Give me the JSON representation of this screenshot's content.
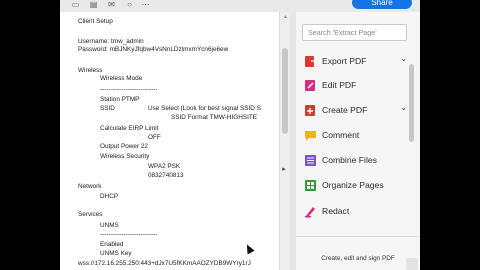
{
  "toolbar": {
    "share_label": "Share",
    "icons": [
      "save-icon",
      "print-icon",
      "mail-icon",
      "search-icon",
      "more-icon"
    ]
  },
  "document": {
    "lines": [
      "Client Setup",
      "Username: tmw_admin",
      "Password: mBJNKyJfqbw4VsNnLDzlmxmYcn6je6ew",
      "Wireless",
      "Wireless Mode",
      "---------------------------",
      "Station PTMP",
      "SSID",
      "Use Select (Look for best signal SSID S",
      "SSID Format   TMW-HIGHSITE",
      "Calculate EIRP Limit",
      "OFF",
      "Output Power 22",
      "Wireless Security",
      "WPA2 PSK",
      "0832740813",
      "Network",
      "DHCP",
      "Services",
      "UNMS",
      "---------------------------",
      "Enabled",
      "UNMS Key",
      "wss://172.16.255.250:443+dJx7U5fKKmAAOZYDB9WYry1rJ"
    ]
  },
  "tools": {
    "search_placeholder": "Search 'Extract Page'",
    "items": [
      {
        "label": "Export PDF",
        "icon": "export-pdf-icon",
        "color": "#d53b2f",
        "has_chevron": true
      },
      {
        "label": "Edit PDF",
        "icon": "edit-pdf-icon",
        "color": "#d0317f",
        "has_chevron": false
      },
      {
        "label": "Create PDF",
        "icon": "create-pdf-icon",
        "color": "#d53b2f",
        "has_chevron": true
      },
      {
        "label": "Comment",
        "icon": "comment-icon",
        "color": "#f4b400",
        "has_chevron": false
      },
      {
        "label": "Combine Files",
        "icon": "combine-files-icon",
        "color": "#7b4fd6",
        "has_chevron": false
      },
      {
        "label": "Organize Pages",
        "icon": "organize-pages-icon",
        "color": "#2e9a3d",
        "has_chevron": false
      },
      {
        "label": "Redact",
        "icon": "redact-icon",
        "color": "#d0317f",
        "has_chevron": false
      }
    ],
    "promo_text": "Create, edit and sign PDF"
  },
  "chevron_glyph": "⌄",
  "collapse_glyph": "▸"
}
